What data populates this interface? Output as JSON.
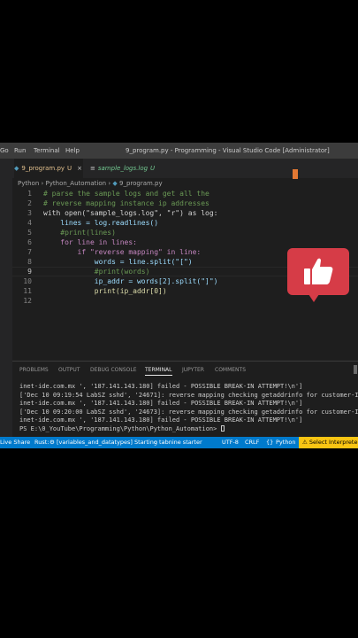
{
  "titlebar": {
    "menu": [
      "Go",
      "Run",
      "Terminal",
      "Help"
    ],
    "title": "9_program.py - Programming - Visual Studio Code [Administrator]"
  },
  "tabs": [
    {
      "label": "9_program.py",
      "mark": "U",
      "close": "×"
    },
    {
      "label": "sample_logs.log",
      "mark": "U"
    }
  ],
  "breadcrumb": {
    "parts": [
      "Python",
      "Python_Automation",
      "9_program.py"
    ],
    "sep": "›"
  },
  "editor": {
    "lines": [
      {
        "n": "1",
        "text": "# parse the sample logs and get all the"
      },
      {
        "n": "2",
        "text": "# reverse mapping instance ip addresses"
      },
      {
        "n": "3",
        "text": "with open(\"sample_logs.log\", \"r\") as log:"
      },
      {
        "n": "4",
        "text": "    lines = log.readlines()"
      },
      {
        "n": "5",
        "text": "    #print(lines)"
      },
      {
        "n": "6",
        "text": "    for line in lines:"
      },
      {
        "n": "7",
        "text": "        if \"reverse mapping\" in line:"
      },
      {
        "n": "8",
        "text": "            words = line.split(\"[\")"
      },
      {
        "n": "9",
        "text": "            #print(words)"
      },
      {
        "n": "10",
        "text": "            ip_addr = words[2].split(\"]\")"
      },
      {
        "n": "11",
        "text": "            print(ip_addr[0])"
      },
      {
        "n": "12",
        "text": ""
      }
    ]
  },
  "panel": {
    "tabs": [
      "PROBLEMS",
      "OUTPUT",
      "DEBUG CONSOLE",
      "TERMINAL",
      "JUPYTER",
      "COMMENTS"
    ],
    "active_tab": "TERMINAL",
    "terminal_lines": [
      "inet-ide.com.mx ', '187.141.143.180] failed - POSSIBLE BREAK-IN ATTEMPT!\\n']",
      "['Dec 10 09:19:54 LabSZ sshd', '24671]: reverse mapping checking getaddrinfo for customer-I",
      "inet-ide.com.mx ', '187.141.143.180] failed - POSSIBLE BREAK-IN ATTEMPT!\\n']",
      "['Dec 10 09:20:00 LabSZ sshd', '24673]: reverse mapping checking getaddrinfo for customer-I",
      "inet-ide.com.mx ', '187.141.143.180] failed - POSSIBLE BREAK-IN ATTEMPT!\\n']"
    ],
    "prompt": "PS E:\\0_YouTube\\Programming\\Python\\Python_Automation> "
  },
  "statusbar": {
    "live_share": "Live Share",
    "rust": "Rust:",
    "rust_status": "[variables_and_datatypes] Starting",
    "tabnine": "o tabnine starter",
    "encoding": "UTF-8",
    "eol": "CRLF",
    "language": "Python",
    "interpreter": "Select Interpreter"
  },
  "colors": {
    "accent": "#007acc",
    "like": "#d63c47"
  }
}
